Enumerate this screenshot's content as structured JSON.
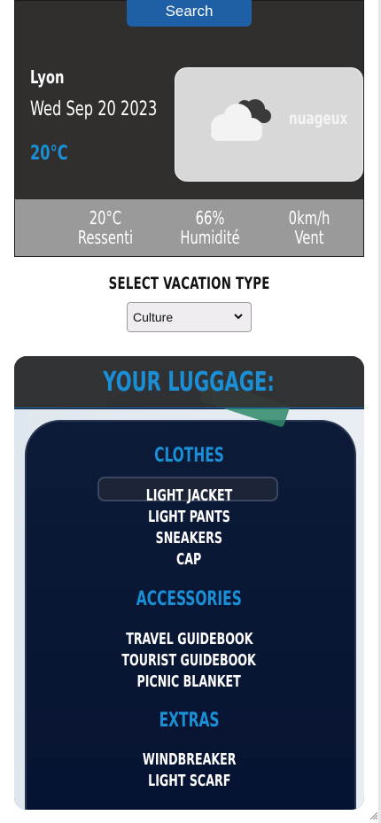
{
  "weather": {
    "search_label": "Search",
    "city": "Lyon",
    "date": "Wed Sep 20 2023",
    "temperature": "20°C",
    "condition": "nuageux",
    "icon": "cloud-icon",
    "stats": {
      "feels_like_value": "20°C",
      "feels_like_label": "Ressenti",
      "humidity_value": "66%",
      "humidity_label": "Humidité",
      "wind_value": "0km/h",
      "wind_label": "Vent"
    }
  },
  "vacation": {
    "title": "SELECT VACATION TYPE",
    "selected": "Culture"
  },
  "luggage": {
    "title": "YOUR LUGGAGE:",
    "sections": [
      {
        "title": "CLOTHES",
        "items": [
          "LIGHT JACKET",
          "LIGHT PANTS",
          "SNEAKERS",
          "CAP"
        ]
      },
      {
        "title": "ACCESSORIES",
        "items": [
          "TRAVEL GUIDEBOOK",
          "TOURIST GUIDEBOOK",
          "PICNIC BLANKET"
        ]
      },
      {
        "title": "EXTRAS",
        "items": [
          "WINDBREAKER",
          "LIGHT SCARF"
        ]
      }
    ]
  },
  "colors": {
    "accent": "#1a8fd6",
    "search_button": "#1f5fa6",
    "card_bg": "#302f2d",
    "stats_bg": "#9a9a9a"
  }
}
